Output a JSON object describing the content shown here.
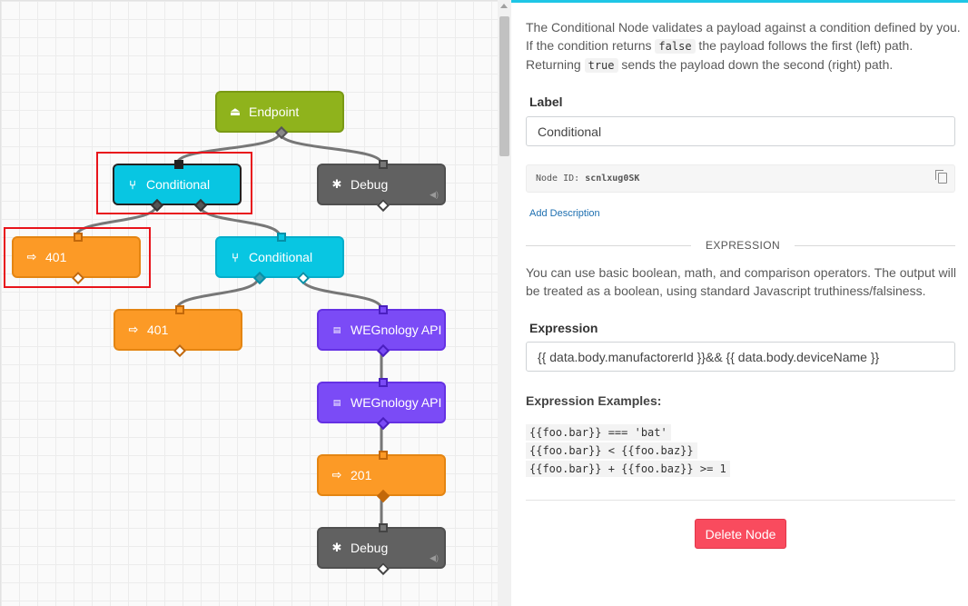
{
  "colors": {
    "endpoint": "#8fb31c",
    "conditional": "#08c6e2",
    "debug": "#616161",
    "response": "#fc9a26",
    "wegnology_api": "#7b4bf6",
    "highlight": "#e8141b",
    "accent": "#1ec6e6",
    "delete": "#f94b5e"
  },
  "canvas": {
    "nodes": [
      {
        "label": "Endpoint",
        "type": "endpoint",
        "icon": "endpoint-icon"
      },
      {
        "label": "Conditional",
        "type": "conditional",
        "icon": "branch-icon",
        "selected": true
      },
      {
        "label": "Debug",
        "type": "debug",
        "icon": "bug-icon"
      },
      {
        "label": "401",
        "type": "response",
        "icon": "response-icon"
      },
      {
        "label": "Conditional",
        "type": "conditional",
        "icon": "branch-icon"
      },
      {
        "label": "401",
        "type": "response",
        "icon": "response-icon"
      },
      {
        "label": "WEGnology API",
        "type": "wegnology_api",
        "icon": "api-icon"
      },
      {
        "label": "WEGnology API",
        "type": "wegnology_api",
        "icon": "api-icon"
      },
      {
        "label": "201",
        "type": "response",
        "icon": "response-icon"
      },
      {
        "label": "Debug",
        "type": "debug",
        "icon": "bug-icon"
      }
    ]
  },
  "panel": {
    "intro": {
      "part1": "The Conditional Node validates a payload against a condition defined by you. If the condition returns ",
      "code_false": "false",
      "part2": " the payload follows the first (left) path. Returning ",
      "code_true": "true",
      "part3": " sends the payload down the second (right) path."
    },
    "label_title": "Label",
    "label_value": "Conditional",
    "node_id_prefix": "Node ID: ",
    "node_id": "scnlxug0SK",
    "add_description": "Add Description",
    "section_title": "EXPRESSION",
    "expression_help": "You can use basic boolean, math, and comparison operators. The output will be treated as a boolean, using standard Javascript truthiness/falsiness.",
    "expression_title": "Expression",
    "expression_value": "{{ data.body.manufactorerId }}&& {{ data.body.deviceName }}",
    "examples_title": "Expression Examples:",
    "examples": [
      "{{foo.bar}} === 'bat'",
      "{{foo.bar}} < {{foo.baz}}",
      "{{foo.bar}} + {{foo.baz}} >= 1"
    ],
    "delete_button": "Delete Node"
  }
}
